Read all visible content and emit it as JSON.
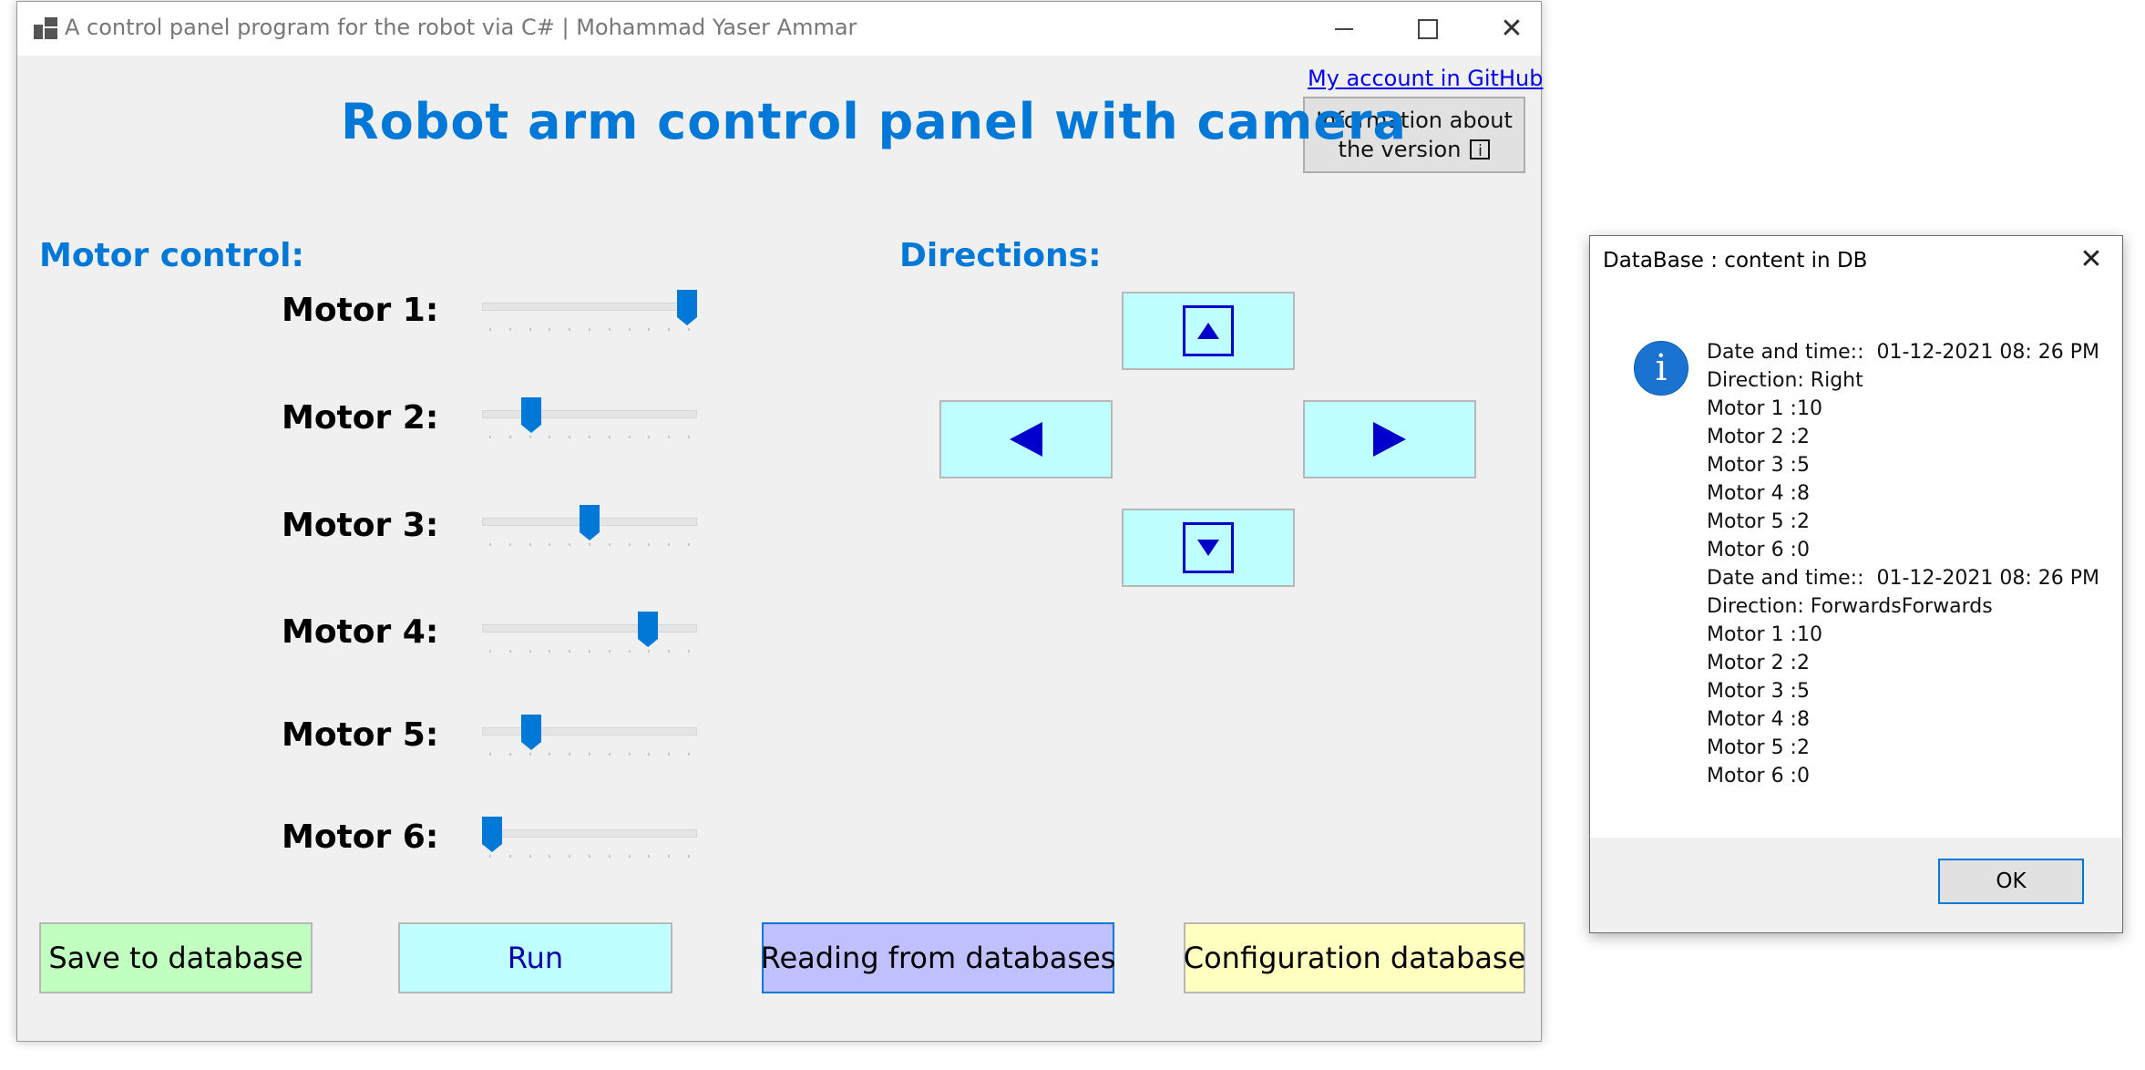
{
  "window": {
    "title": "A control panel program for the robot via C# | Mohammad Yaser Ammar",
    "github_link": "My account in GitHub",
    "info_button": {
      "line1": "Information about",
      "line2": "the version",
      "icon": "i"
    },
    "heading": "Robot arm control panel with camera"
  },
  "motor_control": {
    "label": "Motor control:",
    "slider_max": 10,
    "motors": [
      {
        "label": "Motor 1:",
        "value": 10
      },
      {
        "label": "Motor 2:",
        "value": 2
      },
      {
        "label": "Motor 3:",
        "value": 5
      },
      {
        "label": "Motor 4:",
        "value": 8
      },
      {
        "label": "Motor 5:",
        "value": 2
      },
      {
        "label": "Motor 6:",
        "value": 0
      }
    ]
  },
  "directions": {
    "label": "Directions:",
    "buttons": [
      "up-boxed-arrow",
      "left-arrow",
      "right-arrow",
      "down-boxed-arrow"
    ]
  },
  "actions": {
    "save": "Save to database",
    "run": "Run",
    "read": "Reading from databases",
    "config": "Configuration database"
  },
  "colors": {
    "accent": "#0078d7",
    "save_bg": "#c0ffc0",
    "run_bg": "#c0ffff",
    "read_bg": "#c0c0ff",
    "config_bg": "#ffffc0",
    "arrow": "#0000cc"
  },
  "dialog": {
    "title": "DataBase : content in DB",
    "icon": "information-icon",
    "lines": [
      "Date and time::  01-12-2021 08: 26 PM",
      "Direction: Right",
      "Motor 1 :10",
      "Motor 2 :2",
      "Motor 3 :5",
      "Motor 4 :8",
      "Motor 5 :2",
      "Motor 6 :0",
      "Date and time::  01-12-2021 08: 26 PM",
      "Direction: ForwardsForwards",
      "Motor 1 :10",
      "Motor 2 :2",
      "Motor 3 :5",
      "Motor 4 :8",
      "Motor 5 :2",
      "Motor 6 :0"
    ],
    "ok": "OK"
  }
}
